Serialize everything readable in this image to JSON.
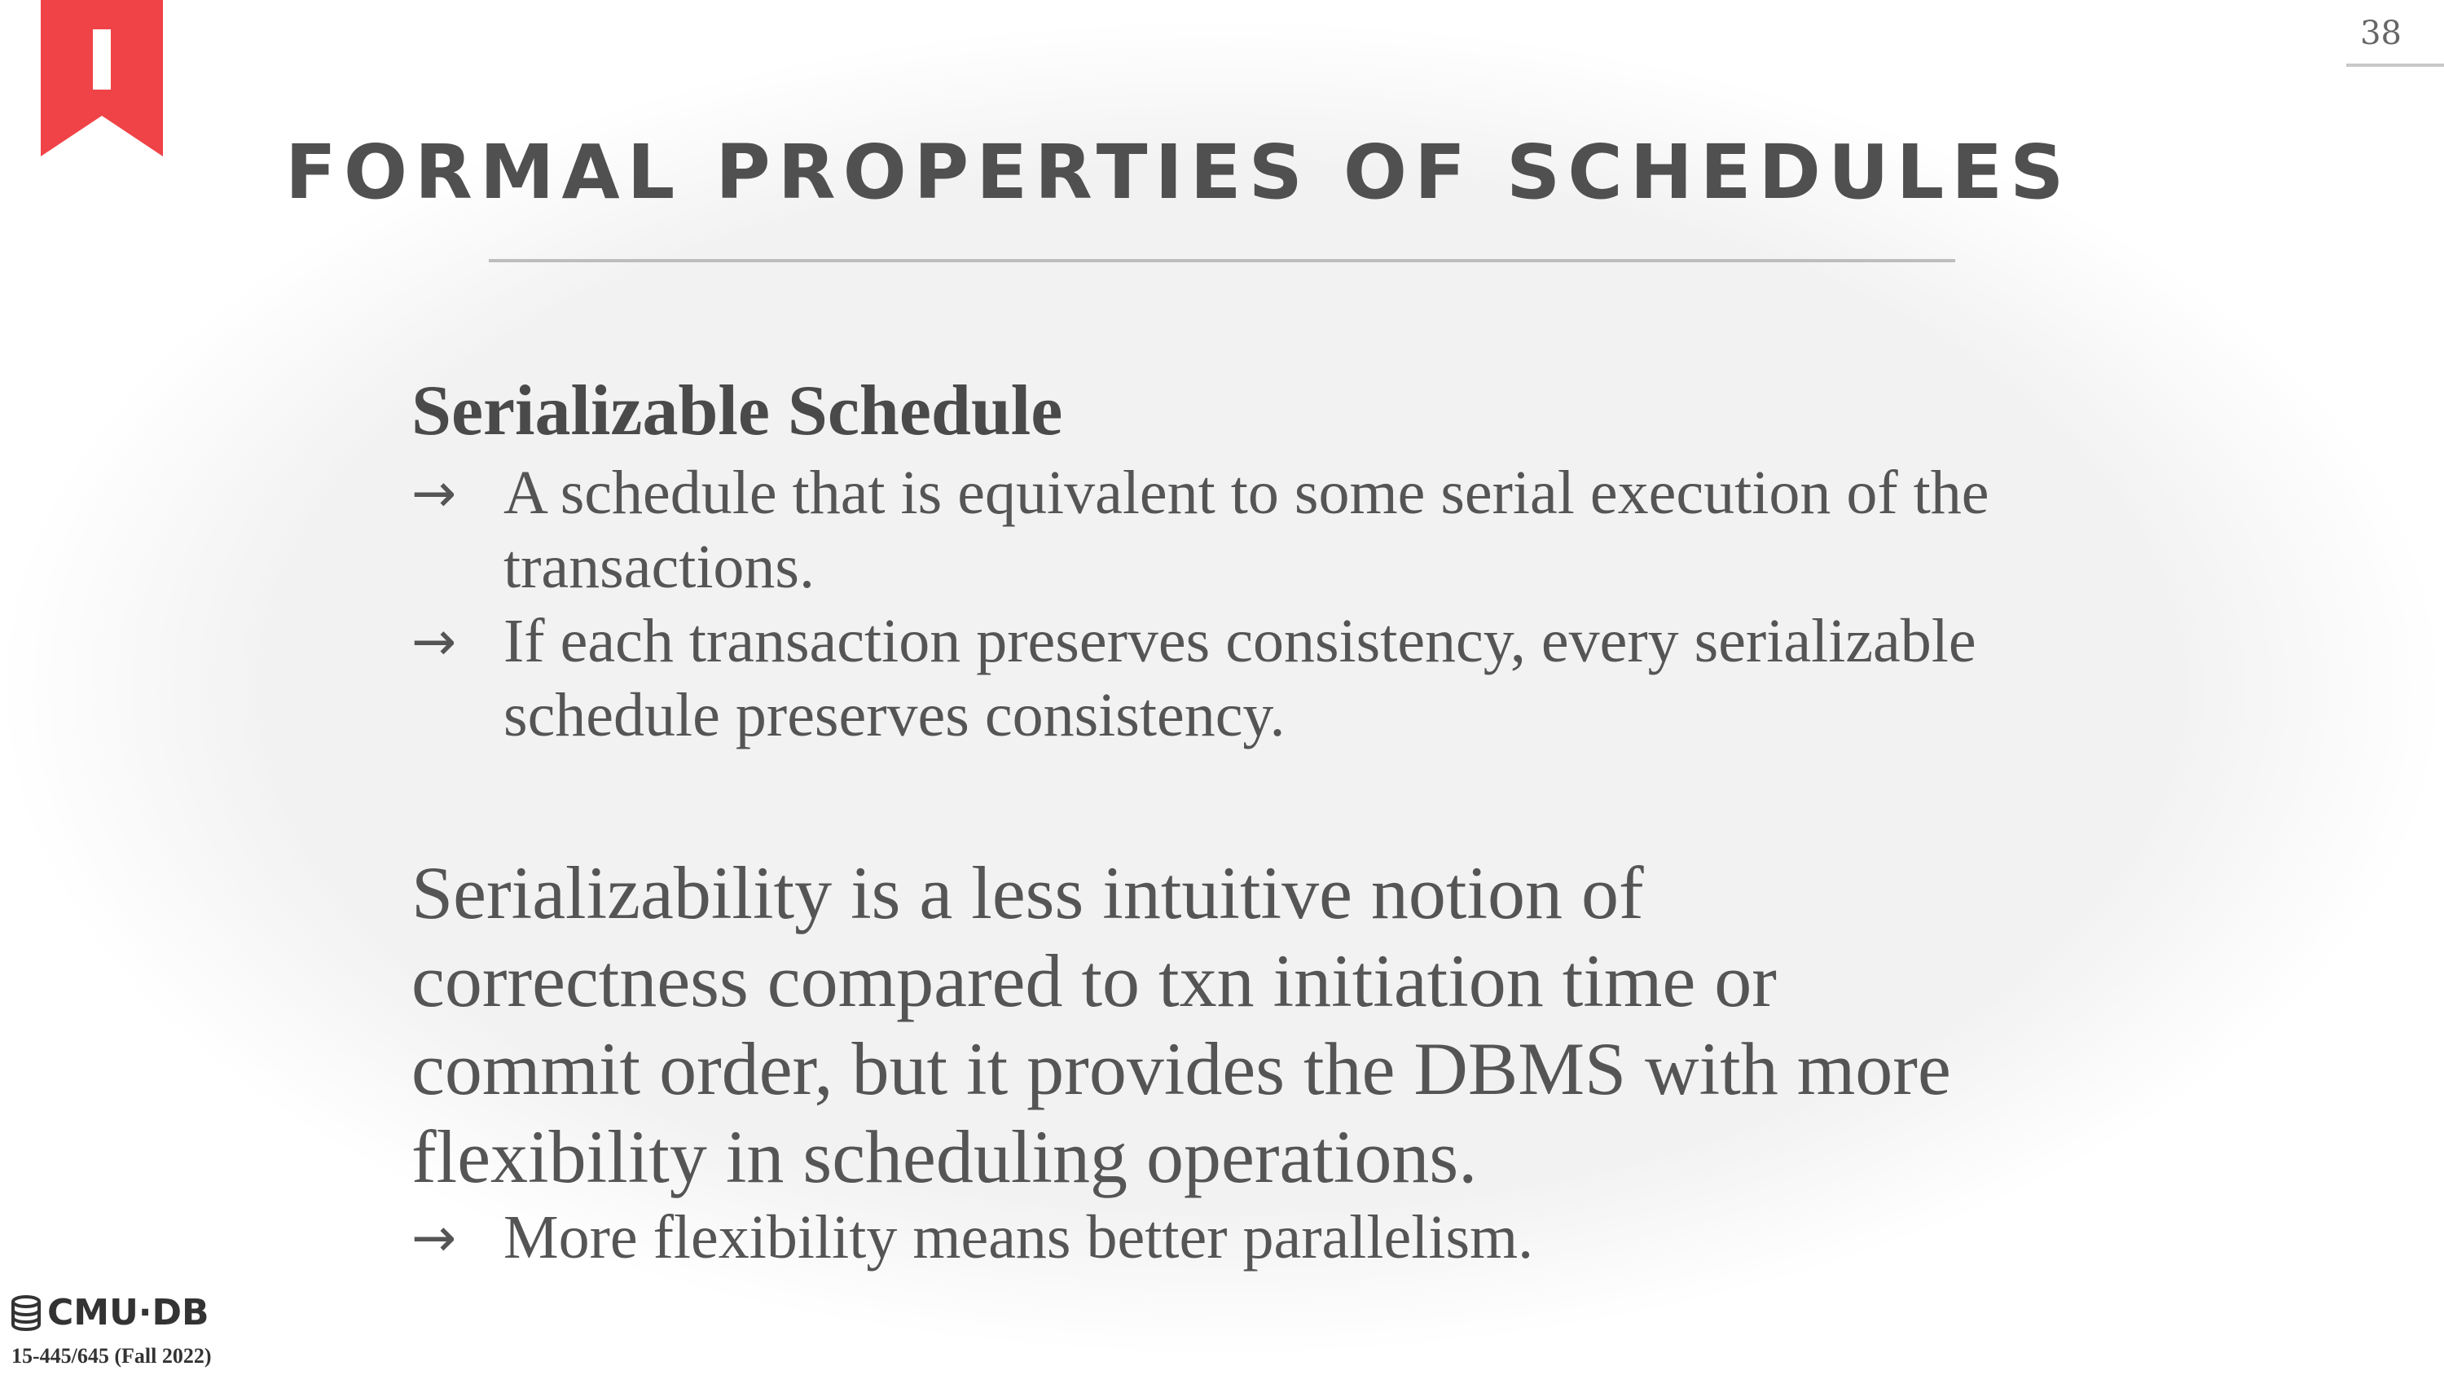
{
  "page_number": "38",
  "title": "FORMAL PROPERTIES OF SCHEDULES",
  "section": {
    "heading": "Serializable Schedule",
    "bullets": [
      "A schedule that is equivalent to some serial execution of the transactions.",
      "If each transaction preserves consistency, every serializable schedule preserves consistency."
    ]
  },
  "paragraph": {
    "text": "Serializability is a less intuitive notion of correctness compared to txn initiation time or commit order, but it provides the DBMS with more flexibility in scheduling operations.",
    "bullet": "More flexibility means better parallelism."
  },
  "arrow_glyph": "→",
  "footer": {
    "logo_text": "CMU·DB",
    "course": "15-445/645 (Fall 2022)"
  },
  "colors": {
    "ribbon": "#f04348",
    "text": "#555555",
    "background": "#f2f2f2"
  },
  "icons": {
    "ribbon": "bookmark-ribbon-icon",
    "logo": "database-icon"
  }
}
